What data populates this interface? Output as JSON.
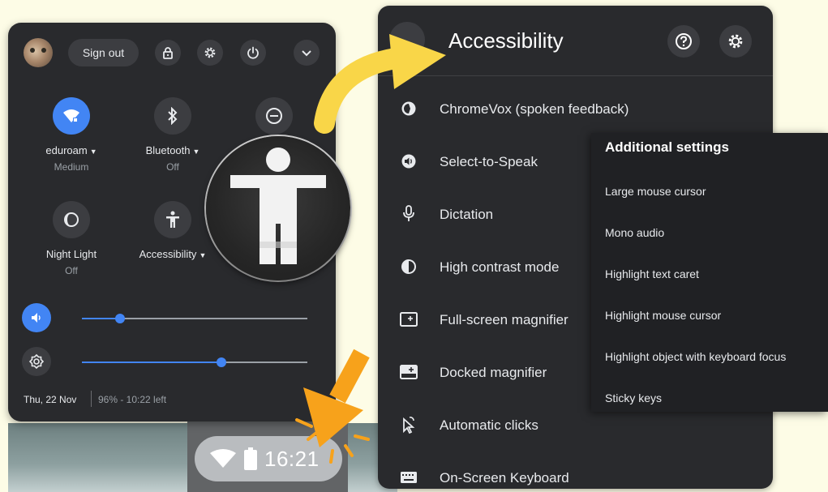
{
  "quick_settings": {
    "sign_out_label": "Sign out",
    "features": [
      {
        "label": "eduroam",
        "sub": "Medium",
        "icon": "wifi-icon",
        "active": true
      },
      {
        "label": "Bluetooth",
        "sub": "Off",
        "icon": "bluetooth-icon",
        "active": false
      },
      {
        "label": "",
        "sub": "",
        "icon": "do-not-disturb-icon",
        "active": false
      },
      {
        "label": "Night Light",
        "sub": "Off",
        "icon": "night-light-icon",
        "active": false
      },
      {
        "label": "Accessibility",
        "sub": "",
        "icon": "accessibility-icon",
        "active": false
      }
    ],
    "volume_level": 0.17,
    "brightness_level": 0.62,
    "date": "Thu, 22 Nov",
    "battery": "96% - 10:22 left"
  },
  "tray": {
    "time": "16:21"
  },
  "accessibility": {
    "title": "Accessibility",
    "items": [
      {
        "label": "ChromeVox (spoken feedback)",
        "icon": "chromevox-icon"
      },
      {
        "label": "Select-to-Speak",
        "icon": "select-to-speak-icon"
      },
      {
        "label": "Dictation",
        "icon": "microphone-icon"
      },
      {
        "label": "High contrast mode",
        "icon": "contrast-icon"
      },
      {
        "label": "Full-screen magnifier",
        "icon": "fullscreen-magnifier-icon"
      },
      {
        "label": "Docked magnifier",
        "icon": "docked-magnifier-icon"
      },
      {
        "label": "Automatic clicks",
        "icon": "auto-click-icon"
      },
      {
        "label": "On-Screen Keyboard",
        "icon": "keyboard-icon"
      }
    ]
  },
  "additional_settings": {
    "title": "Additional settings",
    "items": [
      "Large mouse cursor",
      "Mono audio",
      "Highlight text caret",
      "Highlight mouse cursor",
      "Highlight object with keyboard focus",
      "Sticky keys"
    ]
  },
  "colors": {
    "panel": "#292a2d",
    "accent": "#4285f4",
    "arrow_yellow": "#f9d648",
    "arrow_orange": "#f7a21b",
    "background": "#fdfce6"
  }
}
